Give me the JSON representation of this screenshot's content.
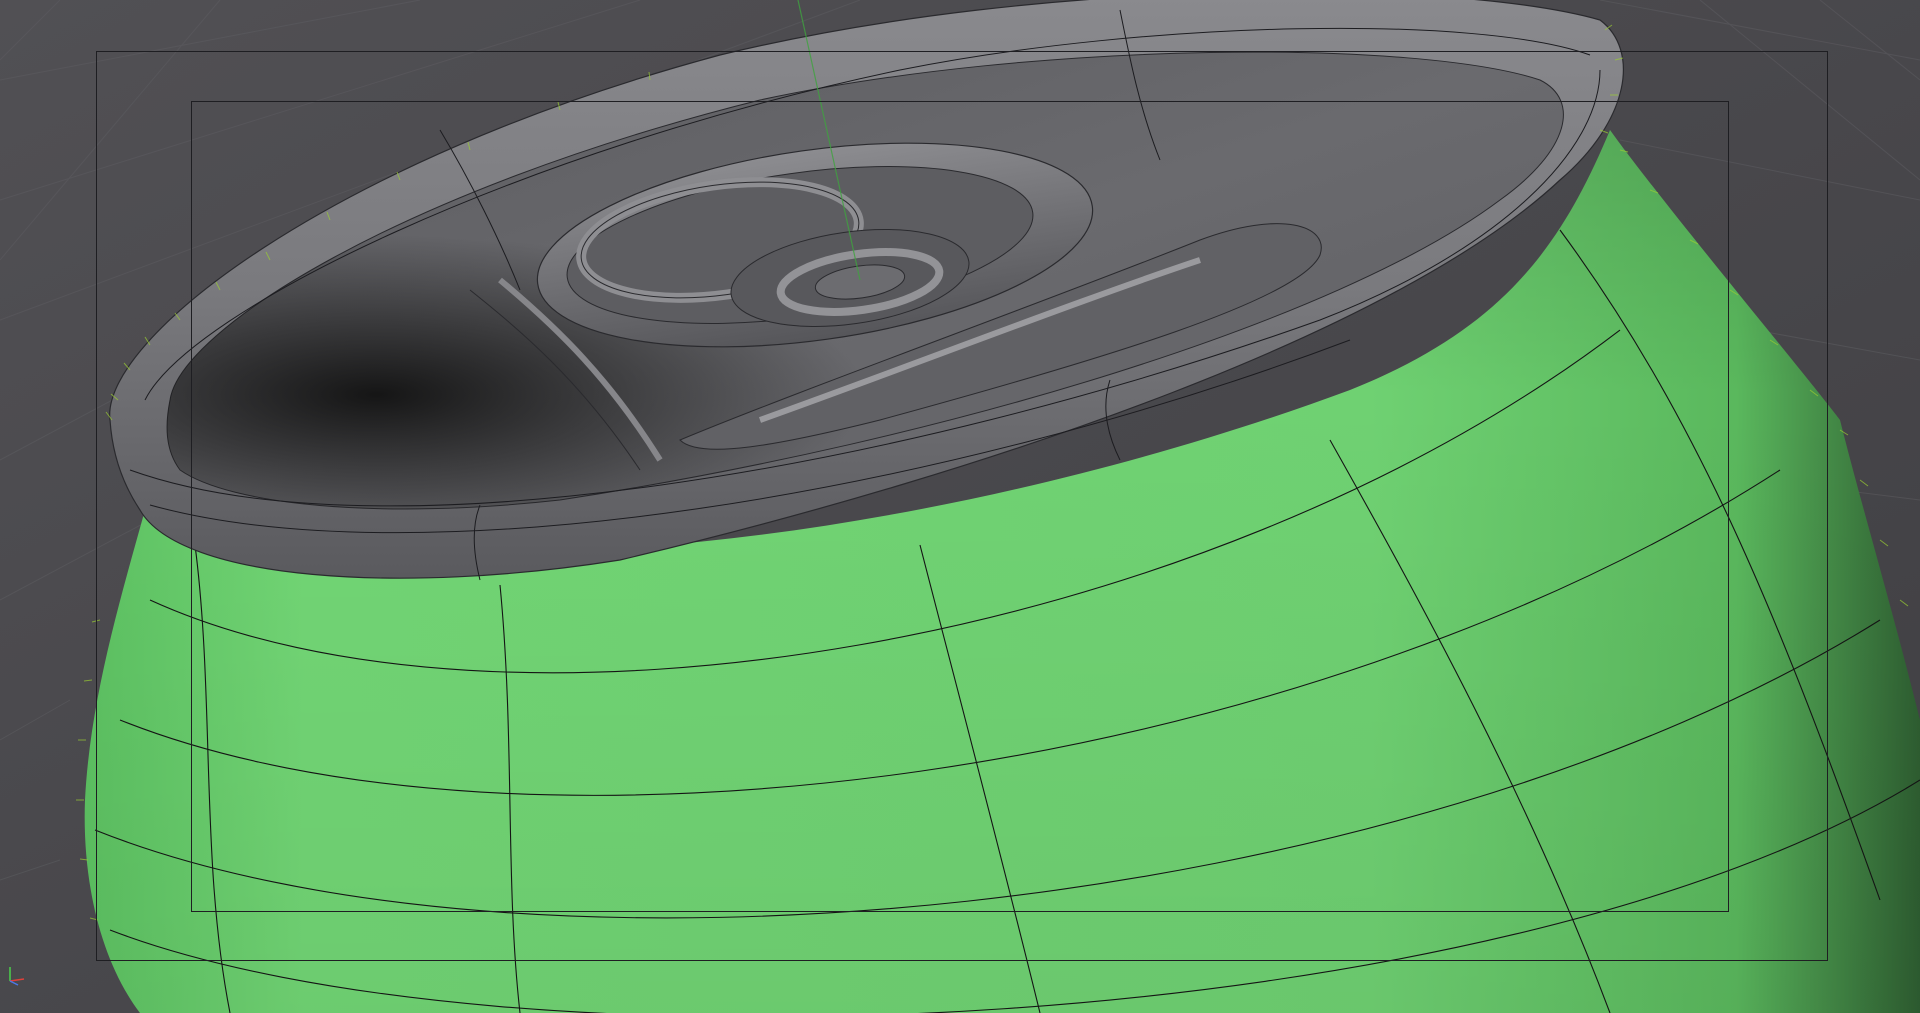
{
  "viewport": {
    "mode": "perspective",
    "background": "#4a494d",
    "grid": true
  },
  "object": {
    "type": "beverage-can",
    "body_color": "#6fd274",
    "lid_color": "#7b7b7f",
    "wireframe_color": "#141414",
    "normals_color": "#9acd32"
  },
  "overlays": {
    "safe_frames": true,
    "icons": [
      "axis-gizmo-icon"
    ]
  },
  "axis_colors": {
    "x": "#e0403a",
    "y": "#4bd04b",
    "z": "#4a78e8"
  }
}
